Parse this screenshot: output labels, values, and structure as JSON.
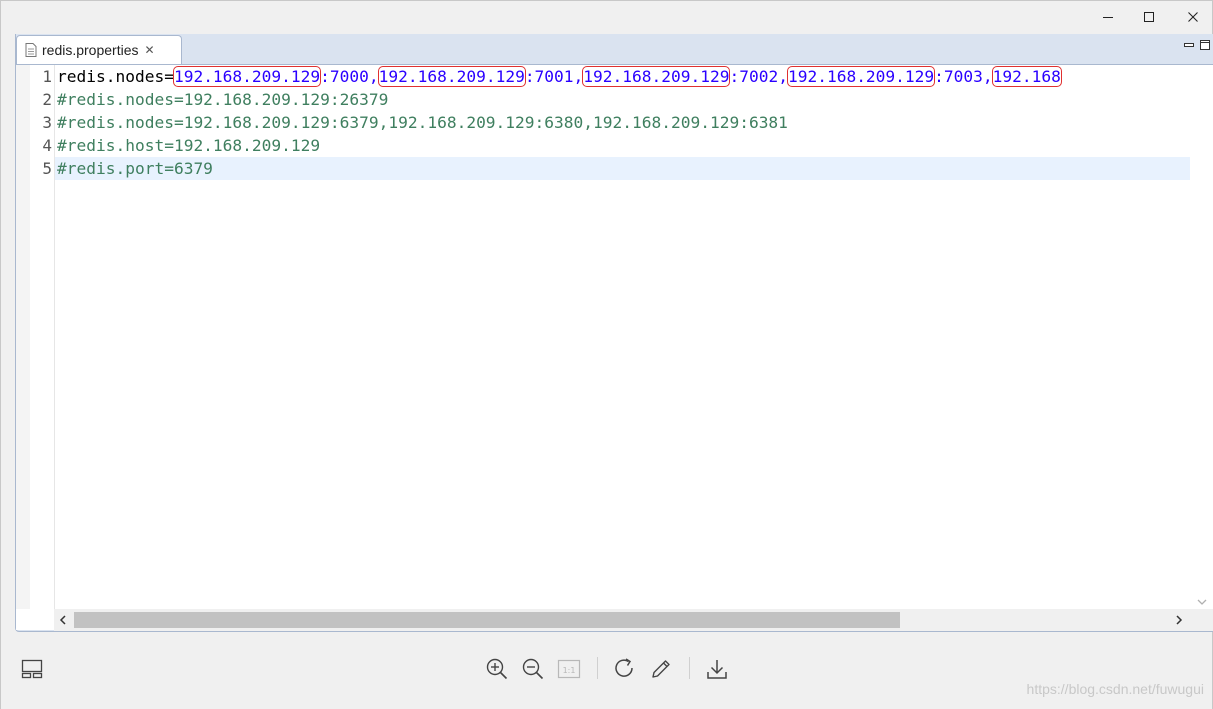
{
  "window": {
    "controls": {
      "minimize": "minimize-icon",
      "maximize": "maximize-icon",
      "close": "close-icon"
    }
  },
  "editor": {
    "tab": {
      "label": "redis.properties",
      "close": "✕",
      "icon": "properties-file-icon"
    },
    "line_numbers": [
      "1",
      "2",
      "3",
      "4",
      "5"
    ],
    "line1": {
      "key": "redis.nodes",
      "eq": "=",
      "ip1": "192.168.209.129",
      "sep1": ":7000,",
      "ip2": "192.168.209.129",
      "sep2": ":7001,",
      "ip3": "192.168.209.129",
      "sep3": ":7002,",
      "ip4": "192.168.209.129",
      "sep4": ":7003,",
      "ip5": "192.168"
    },
    "line2": "#redis.nodes=192.168.209.129:26379",
    "line3": "#redis.nodes=192.168.209.129:6379,192.168.209.129:6380,192.168.209.129:6381",
    "line4": "#redis.host=192.168.209.129",
    "line5": "#redis.port=6379",
    "current_line": 5,
    "highlight_color": "#e03030",
    "colors": {
      "key": "#000000",
      "value": "#2a00ff",
      "comment": "#3f7f5f",
      "current_line_bg": "#e8f2fe"
    }
  },
  "toolbar": {
    "icons": [
      "panel-layout-icon",
      "zoom-in-icon",
      "zoom-out-icon",
      "actual-size-icon",
      "rotate-icon",
      "edit-pen-icon",
      "download-icon"
    ],
    "actual_size_label": "1:1"
  },
  "watermark": "https://blog.csdn.net/fuwugui"
}
